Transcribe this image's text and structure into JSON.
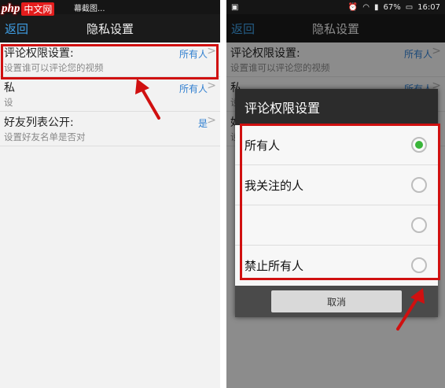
{
  "watermark": {
    "logo_text": "php",
    "cn_text": "中文网"
  },
  "left_phone": {
    "status_bar": {
      "left_text": "幕截图..."
    },
    "nav": {
      "back_label": "返回",
      "title": "隐私设置"
    },
    "rows": [
      {
        "label": "评论权限设置:",
        "sub": "设置谁可以评论您的视频",
        "value": "所有人"
      },
      {
        "label": "私",
        "sub": "设",
        "value": "所有人"
      },
      {
        "label": "好友列表公开:",
        "sub": "设置好友名单是否对",
        "value": "是"
      }
    ],
    "arrow_glyph": ">"
  },
  "right_phone": {
    "status_bar": {
      "battery": "67%",
      "time": "16:07"
    },
    "nav": {
      "back_label": "返回",
      "title": "隐私设置"
    },
    "rows": [
      {
        "label": "评论权限设置:",
        "sub": "设置谁可以评论您的视频",
        "value": "所有人"
      },
      {
        "label": "私",
        "sub": "设",
        "value": "所有人"
      },
      {
        "label": "好",
        "sub": "设",
        "value": ""
      }
    ],
    "dialog": {
      "title": "评论权限设置",
      "options": [
        {
          "label": "所有人",
          "checked": true
        },
        {
          "label": "我关注的人",
          "checked": false
        },
        {
          "label": "",
          "checked": false
        },
        {
          "label": "禁止所有人",
          "checked": false
        }
      ],
      "cancel_label": "取消"
    }
  },
  "colors": {
    "accent_blue": "#3f9fe6",
    "highlight_red": "#d01010",
    "radio_green": "#3ab53a"
  }
}
